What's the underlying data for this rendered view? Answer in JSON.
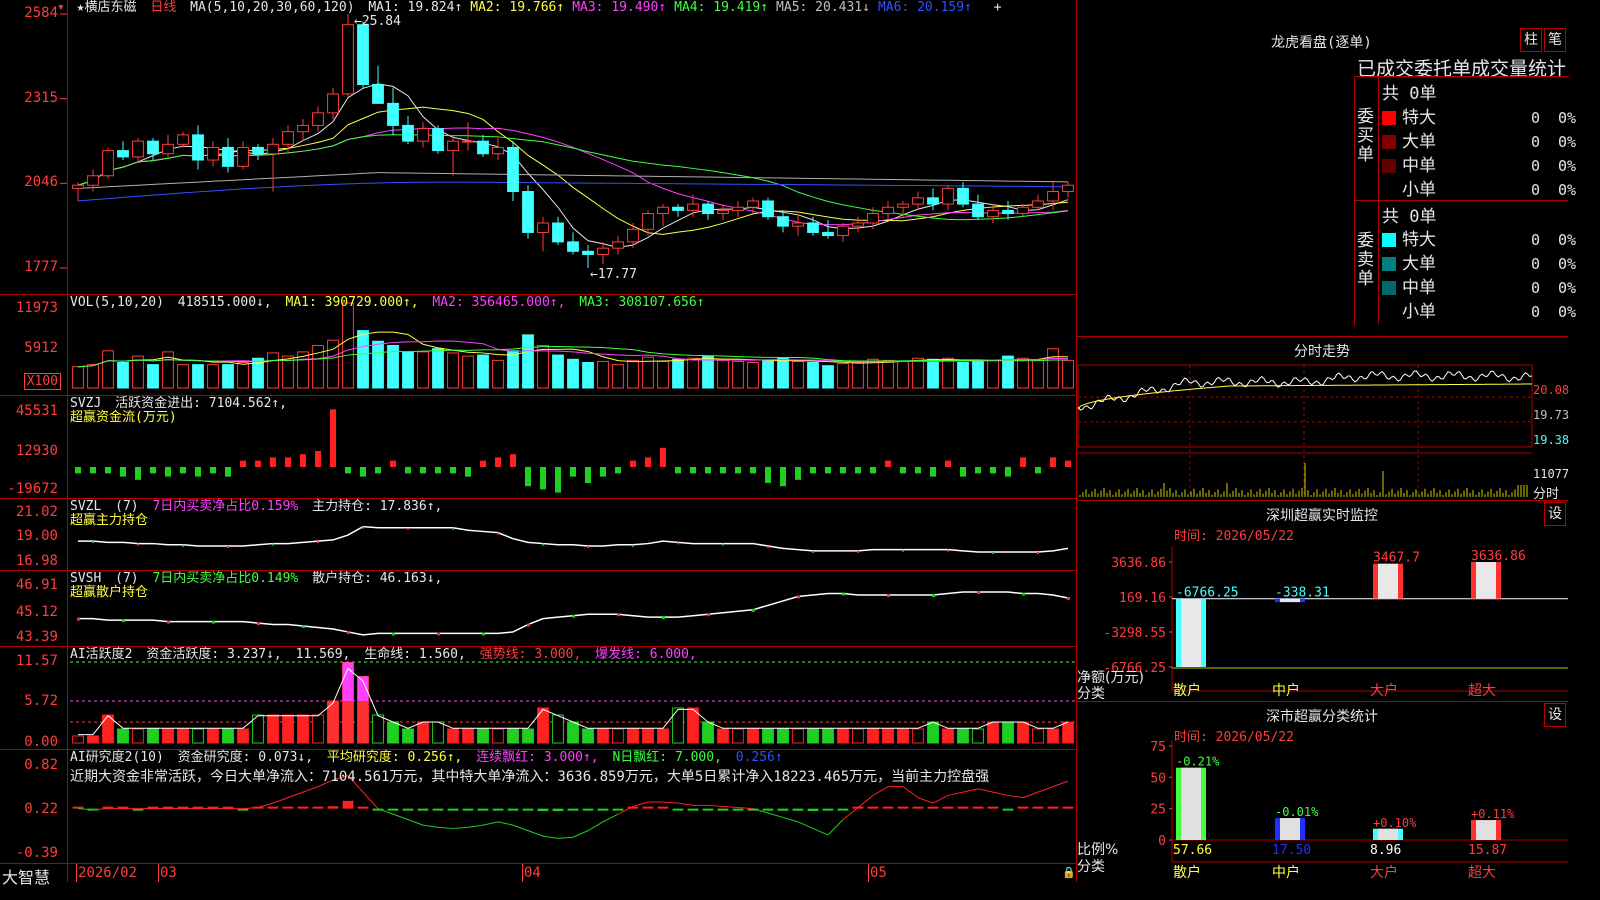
{
  "kline": {
    "title": "★横店东磁",
    "period": "日线",
    "ma_spec": "MA(5,10,20,30,60,120)",
    "ma_values": [
      {
        "label": "MA1: 19.824↑",
        "color": "#e6e6e6"
      },
      {
        "label": "MA2: 19.766↑",
        "color": "#ffff40"
      },
      {
        "label": "MA3: 19.490↑",
        "color": "#ff40ff"
      },
      {
        "label": "MA4: 19.419↑",
        "color": "#40ff40"
      },
      {
        "label": "MA5: 20.431↓",
        "color": "#c0c0c0"
      },
      {
        "label": "MA6: 20.159↑",
        "color": "#3050ff"
      }
    ],
    "high_label": "25.84",
    "low_label": "17.77",
    "y_ticks": [
      "2584",
      "2315",
      "2046",
      "1777"
    ],
    "candles": [
      [
        20.3,
        20.5,
        19.9,
        20.4
      ],
      [
        20.4,
        20.9,
        20.2,
        20.7
      ],
      [
        20.7,
        21.6,
        20.6,
        21.5
      ],
      [
        21.5,
        21.8,
        21.2,
        21.3
      ],
      [
        21.3,
        21.9,
        21.1,
        21.8
      ],
      [
        21.8,
        21.9,
        21.2,
        21.4
      ],
      [
        21.4,
        22.0,
        21.3,
        21.7
      ],
      [
        21.7,
        22.1,
        21.6,
        22.0
      ],
      [
        22.0,
        22.3,
        20.9,
        21.2
      ],
      [
        21.2,
        21.8,
        21.0,
        21.6
      ],
      [
        21.6,
        21.9,
        20.8,
        21.0
      ],
      [
        21.0,
        21.8,
        20.9,
        21.6
      ],
      [
        21.6,
        21.7,
        21.2,
        21.4
      ],
      [
        21.4,
        21.9,
        20.2,
        21.7
      ],
      [
        21.7,
        22.3,
        21.4,
        22.1
      ],
      [
        22.1,
        22.5,
        21.8,
        22.3
      ],
      [
        22.3,
        22.9,
        22.1,
        22.7
      ],
      [
        22.7,
        23.5,
        22.5,
        23.3
      ],
      [
        23.3,
        25.84,
        23.2,
        25.5
      ],
      [
        25.5,
        25.6,
        23.5,
        23.6
      ],
      [
        23.6,
        24.2,
        23.0,
        23.0
      ],
      [
        23.0,
        23.5,
        22.0,
        22.3
      ],
      [
        22.3,
        22.6,
        21.7,
        21.8
      ],
      [
        21.8,
        22.4,
        21.6,
        22.2
      ],
      [
        22.2,
        22.3,
        21.4,
        21.5
      ],
      [
        21.5,
        22.0,
        20.7,
        21.8
      ],
      [
        21.8,
        22.4,
        21.5,
        21.8
      ],
      [
        21.8,
        22.0,
        21.3,
        21.4
      ],
      [
        21.4,
        21.9,
        21.2,
        21.6
      ],
      [
        21.6,
        21.8,
        19.9,
        20.2
      ],
      [
        20.2,
        20.4,
        18.7,
        18.9
      ],
      [
        18.9,
        19.4,
        18.3,
        19.2
      ],
      [
        19.2,
        19.4,
        18.5,
        18.6
      ],
      [
        18.6,
        18.9,
        18.2,
        18.3
      ],
      [
        18.3,
        18.5,
        17.77,
        18.2
      ],
      [
        18.2,
        18.6,
        17.9,
        18.4
      ],
      [
        18.4,
        18.8,
        18.2,
        18.6
      ],
      [
        18.6,
        19.2,
        18.4,
        19.0
      ],
      [
        19.0,
        19.6,
        18.8,
        19.5
      ],
      [
        19.5,
        19.8,
        19.1,
        19.7
      ],
      [
        19.7,
        19.8,
        19.4,
        19.6
      ],
      [
        19.6,
        20.1,
        19.4,
        19.8
      ],
      [
        19.8,
        19.9,
        19.3,
        19.5
      ],
      [
        19.5,
        19.8,
        19.3,
        19.6
      ],
      [
        19.6,
        19.9,
        19.4,
        19.7
      ],
      [
        19.7,
        20.0,
        19.5,
        19.9
      ],
      [
        19.9,
        20.0,
        19.3,
        19.4
      ],
      [
        19.4,
        19.6,
        18.9,
        19.1
      ],
      [
        19.1,
        19.5,
        18.8,
        19.2
      ],
      [
        19.2,
        19.4,
        18.8,
        18.9
      ],
      [
        18.9,
        19.3,
        18.7,
        18.8
      ],
      [
        18.8,
        19.2,
        18.6,
        19.1
      ],
      [
        19.1,
        19.4,
        18.9,
        19.2
      ],
      [
        19.2,
        19.7,
        19.0,
        19.5
      ],
      [
        19.5,
        19.9,
        19.3,
        19.7
      ],
      [
        19.7,
        19.9,
        19.4,
        19.8
      ],
      [
        19.8,
        20.2,
        19.6,
        20.0
      ],
      [
        20.0,
        20.3,
        19.6,
        19.8
      ],
      [
        19.8,
        20.4,
        19.6,
        20.3
      ],
      [
        20.3,
        20.5,
        19.7,
        19.8
      ],
      [
        19.8,
        20.1,
        19.3,
        19.4
      ],
      [
        19.4,
        19.8,
        19.2,
        19.6
      ],
      [
        19.6,
        19.9,
        19.3,
        19.5
      ],
      [
        19.5,
        19.8,
        19.4,
        19.7
      ],
      [
        19.7,
        20.1,
        19.6,
        19.9
      ],
      [
        19.9,
        20.5,
        19.6,
        20.2
      ],
      [
        20.2,
        20.5,
        20.0,
        20.4
      ]
    ]
  },
  "vol": {
    "header": "VOL(5,10,20)",
    "value": "418515.000↓,",
    "ma1": "MA1: 390729.000↑,",
    "ma2": "MA2: 356465.000↑,",
    "ma3": "MA3: 308107.656↑",
    "y_ticks": [
      "11973",
      "5912"
    ],
    "unit_box": "X100",
    "bars": [
      20,
      22,
      35,
      24,
      30,
      22,
      34,
      22,
      22,
      22,
      22,
      24,
      28,
      33,
      30,
      34,
      40,
      45,
      80,
      54,
      44,
      40,
      34,
      34,
      37,
      33,
      30,
      31,
      26,
      35,
      50,
      40,
      31,
      27,
      24,
      25,
      22,
      26,
      29,
      25,
      27,
      28,
      30,
      26,
      25,
      24,
      26,
      28,
      25,
      24,
      21,
      23,
      24,
      27,
      26,
      25,
      28,
      27,
      28,
      24,
      25,
      26,
      30,
      28,
      26,
      37,
      26
    ]
  },
  "svzj": {
    "label": "SVZJ",
    "desc": "活跃资金进出: 7104.562↑,",
    "sub": "超赢资金流(万元)",
    "y_ticks": [
      "45531",
      "12930",
      "-19672"
    ],
    "values": [
      -2,
      -2,
      -2,
      -3,
      -4,
      -2,
      -3,
      -2,
      -3,
      -2,
      -3,
      2,
      2,
      3,
      3,
      4,
      5,
      18,
      -2,
      -3,
      -2,
      2,
      -2,
      -2,
      -2,
      -2,
      -3,
      2,
      3,
      4,
      -6,
      -7,
      -8,
      -3,
      -5,
      -3,
      -2,
      2,
      3,
      6,
      -2,
      -2,
      -2,
      -2,
      -2,
      -2,
      -5,
      -6,
      -4,
      -2,
      -2,
      -2,
      -2,
      -2,
      2,
      -2,
      -2,
      -3,
      2,
      -3,
      -2,
      -2,
      -3,
      3,
      -2,
      3,
      2
    ]
  },
  "svzl": {
    "label": "SVZL",
    "desc1": "(7)",
    "desc2": "7日内买卖净占比0.159%",
    "desc3": "主力持仓: 17.836↑,",
    "sub": "超赢主力持仓",
    "y_ticks": [
      "21.02",
      "19.00",
      "16.98"
    ],
    "line": [
      18.7,
      18.7,
      18.6,
      18.6,
      18.5,
      18.5,
      18.4,
      18.4,
      18.3,
      18.3,
      18.3,
      18.3,
      18.4,
      18.5,
      18.5,
      18.6,
      18.7,
      18.8,
      19.2,
      19.9,
      19.8,
      19.8,
      19.8,
      19.8,
      19.8,
      19.8,
      19.6,
      19.5,
      19.4,
      18.9,
      18.6,
      18.5,
      18.4,
      18.4,
      18.3,
      18.3,
      18.4,
      18.4,
      18.5,
      18.7,
      18.6,
      18.5,
      18.5,
      18.5,
      18.5,
      18.5,
      18.3,
      18.1,
      18.0,
      17.9,
      17.9,
      17.9,
      17.9,
      18.0,
      18.0,
      18.0,
      18.0,
      18.0,
      18.0,
      17.9,
      17.8,
      17.8,
      17.8,
      17.8,
      17.8,
      17.9,
      18.1
    ]
  },
  "svsh": {
    "label": "SVSH",
    "desc1": "(7)",
    "desc2": "7日内买卖净占比0.149%",
    "desc3": "散户持仓: 46.163↓,",
    "sub": "超赢散户持仓",
    "y_ticks": [
      "46.91",
      "45.12",
      "43.39"
    ],
    "line": [
      44.7,
      44.7,
      44.6,
      44.6,
      44.6,
      44.6,
      44.5,
      44.5,
      44.5,
      44.5,
      44.5,
      44.5,
      44.4,
      44.3,
      44.3,
      44.2,
      44.1,
      44.0,
      43.8,
      43.6,
      43.7,
      43.7,
      43.7,
      43.7,
      43.7,
      43.7,
      43.7,
      43.7,
      43.7,
      43.8,
      44.3,
      44.7,
      44.8,
      44.9,
      45.0,
      45.0,
      45.0,
      44.9,
      44.8,
      44.8,
      44.8,
      44.9,
      45.0,
      45.1,
      45.2,
      45.3,
      45.6,
      45.9,
      46.2,
      46.3,
      46.4,
      46.4,
      46.3,
      46.3,
      46.3,
      46.3,
      46.3,
      46.3,
      46.4,
      46.5,
      46.5,
      46.5,
      46.5,
      46.4,
      46.4,
      46.3,
      46.1
    ]
  },
  "ai": {
    "label": "AI活跃度2",
    "desc1": "资金活跃度: 3.237↓,",
    "desc2": "11.569,",
    "desc3": "生命线: 1.560,",
    "desc4": "强势线: 3.000,",
    "desc5": "爆发线: 6.000,",
    "y_ticks": [
      "11.57",
      "5.72",
      "0.00"
    ],
    "bars": [
      1,
      1,
      4,
      2,
      2,
      2,
      2,
      2,
      2,
      2,
      2,
      2,
      4,
      4,
      4,
      4,
      4,
      6,
      11.5,
      9.5,
      4,
      3,
      2,
      3,
      3,
      2,
      2,
      2,
      2,
      2,
      2,
      5,
      4,
      3,
      2,
      2,
      2,
      2,
      2,
      2,
      5,
      5,
      3,
      2,
      2,
      2,
      2,
      2,
      2,
      2,
      2,
      2,
      2,
      2,
      2,
      2,
      2,
      3,
      2,
      2,
      2,
      3,
      3,
      3,
      2,
      2,
      3,
      3.5,
      4.5,
      4,
      3.5
    ]
  },
  "research": {
    "label": "AI研究度2(10)",
    "desc1": "资金研究度: 0.073↓,",
    "desc2": "平均研究度: 0.256↑,",
    "desc3": "连续飘红: 3.000↑,",
    "desc4": "N日飘红: 7.000,",
    "desc5": "0.256↑",
    "comment": "近期大资金非常活跃，今日大单净流入：7104.561万元，其中特大单净流入：3636.859万元，大单5日累计净入18223.465万元，当前主力控盘强",
    "y_ticks": [
      "0.82",
      "0.22",
      "-0.39"
    ],
    "bars": [
      0.0,
      -0.02,
      0.03,
      0.03,
      -0.05,
      0.02,
      0.02,
      0.02,
      0.01,
      0.0,
      0.0,
      -0.01,
      0.02,
      0.04,
      0.05,
      0.06,
      0.06,
      0.08,
      0.26,
      0.03,
      -0.01,
      -0.02,
      -0.03,
      -0.03,
      -0.03,
      -0.02,
      -0.02,
      -0.03,
      -0.04,
      -0.06,
      -0.06,
      -0.08,
      -0.08,
      -0.06,
      -0.04,
      -0.03,
      -0.02,
      0.03,
      0.05,
      0.03,
      -0.03,
      -0.03,
      -0.03,
      -0.03,
      -0.04,
      -0.05,
      -0.06,
      -0.07,
      -0.07,
      -0.08,
      -0.06,
      -0.03,
      0.04,
      0.05,
      0.06,
      0.05,
      0.03,
      0.05,
      0.04,
      0.05,
      0.05,
      0.03,
      -0.02,
      0.04,
      0.05,
      0.06,
      0.05
    ],
    "line": [
      0.0,
      -0.01,
      0.0,
      0.0,
      0.0,
      0.0,
      0.0,
      0.0,
      0.0,
      0.0,
      0.0,
      0.0,
      0.01,
      0.05,
      0.1,
      0.15,
      0.2,
      0.26,
      0.3,
      0.15,
      0.0,
      -0.05,
      -0.1,
      -0.15,
      -0.17,
      -0.18,
      -0.17,
      -0.15,
      -0.12,
      -0.15,
      -0.2,
      -0.25,
      -0.27,
      -0.26,
      -0.2,
      -0.12,
      -0.05,
      0.02,
      0.06,
      0.06,
      0.05,
      0.03,
      0.03,
      0.02,
      0.01,
      0.0,
      -0.04,
      -0.08,
      -0.12,
      -0.18,
      -0.24,
      -0.1,
      0.01,
      0.12,
      0.2,
      0.2,
      0.1,
      0.05,
      0.12,
      0.15,
      0.18,
      0.15,
      0.12,
      0.1,
      0.15,
      0.2,
      0.25
    ]
  },
  "xaxis": {
    "brand": "大智慧",
    "labels": [
      "2026/02",
      "03",
      "04",
      "05"
    ]
  },
  "lhb": {
    "title": "龙虎看盘(逐单)",
    "btn1": "柱",
    "btn2": "笔",
    "subtitle": "已成交委托单成交量统计",
    "buy_side": "委买单",
    "sell_side": "委卖单",
    "buy_total": "共 0单",
    "sell_total": "共 0单",
    "buy_rows": [
      {
        "name": "特大",
        "count": "0",
        "pct": "0%",
        "color": "#ff0000"
      },
      {
        "name": "大单",
        "count": "0",
        "pct": "0%",
        "color": "#800000"
      },
      {
        "name": "中单",
        "count": "0",
        "pct": "0%",
        "color": "#600000"
      },
      {
        "name": "小单",
        "count": "0",
        "pct": "0%",
        "color": "#000000"
      }
    ],
    "sell_rows": [
      {
        "name": "特大",
        "count": "0",
        "pct": "0%",
        "color": "#00ffff"
      },
      {
        "name": "大单",
        "count": "0",
        "pct": "0%",
        "color": "#008080"
      },
      {
        "name": "中单",
        "count": "0",
        "pct": "0%",
        "color": "#006a6a"
      },
      {
        "name": "小单",
        "count": "0",
        "pct": "0%",
        "color": "#000000"
      }
    ]
  },
  "intraday": {
    "title": "分时走势",
    "y_ticks": [
      "20.08",
      "19.73",
      "19.38"
    ],
    "vol_label": "11077",
    "vol_unit": "分时"
  },
  "sz_monitor": {
    "title": "深圳超赢实时监控",
    "btn": "设",
    "time": "时间: 2026/05/22",
    "y_ticks": [
      "3636.86",
      "169.16",
      "-3298.55",
      "-6766.25"
    ],
    "unit": "净额(万元)",
    "cat_label": "分类",
    "categories": [
      "散户",
      "中户",
      "大户",
      "超大"
    ],
    "values": [
      -6766.25,
      -338.31,
      3467.7,
      3636.86
    ],
    "value_labels": [
      "-6766.25",
      "-338.31",
      "3467.7",
      "3636.86"
    ]
  },
  "sz_stats": {
    "title": "深市超赢分类统计",
    "btn": "设",
    "time": "时间: 2026/05/22",
    "y_ticks": [
      "75",
      "50",
      "25",
      "0"
    ],
    "unit": "比例%",
    "cat_label": "分类",
    "categories": [
      "散户",
      "中户",
      "大户",
      "超大"
    ],
    "values": [
      57.66,
      17.5,
      8.96,
      15.87
    ],
    "changes": [
      "-0.21%",
      "-0.01%",
      "+0.10%",
      "+0.11%"
    ]
  }
}
